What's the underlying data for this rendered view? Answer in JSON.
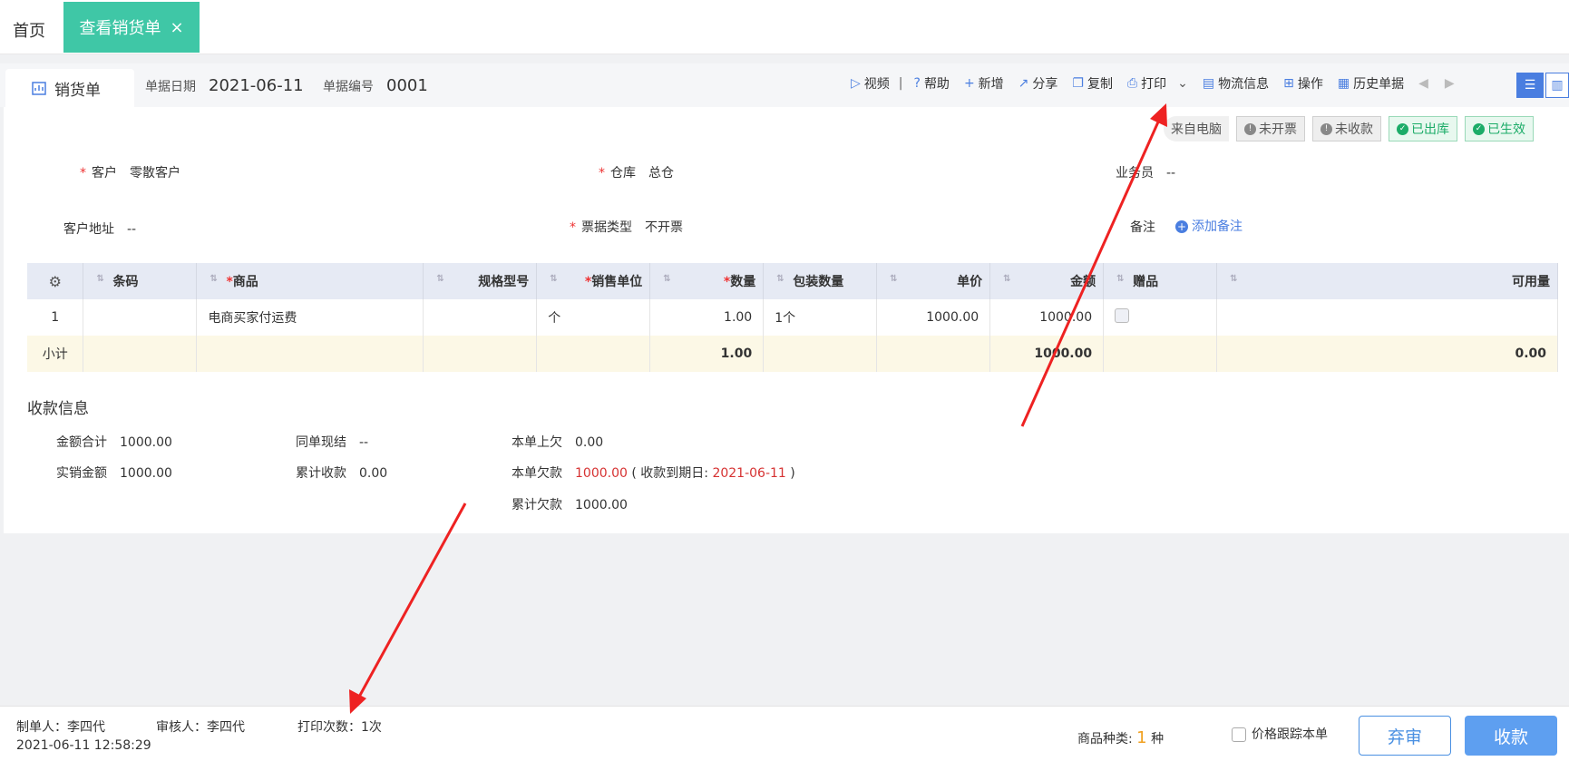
{
  "tabs": {
    "home": "首页",
    "active": "查看销货单",
    "close": "×"
  },
  "doc": {
    "title": "销货单",
    "date_label": "单据日期",
    "date": "2021-06-11",
    "no_label": "单据编号",
    "no": "0001"
  },
  "toolbar": {
    "video": "视频",
    "help": "帮助",
    "add": "新增",
    "share": "分享",
    "copy": "复制",
    "print": "打印",
    "logistics": "物流信息",
    "ops": "操作",
    "history": "历史单据",
    "sep": "|"
  },
  "badges": {
    "source": "来自电脑",
    "invoice": "未开票",
    "receipt": "未收款",
    "outbound": "已出库",
    "effective": "已生效"
  },
  "fields": {
    "customer_label": "客户",
    "customer": "零散客户",
    "warehouse_label": "仓库",
    "warehouse": "总仓",
    "salesman_label": "业务员",
    "salesman": "--",
    "address_label": "客户地址",
    "address": "--",
    "invoice_type_label": "票据类型",
    "invoice_type": "不开票",
    "note_label": "备注",
    "add_note": "添加备注"
  },
  "grid": {
    "headers": {
      "barcode": "条码",
      "product": "商品",
      "spec": "规格型号",
      "unit": "销售单位",
      "qty": "数量",
      "pack": "包装数量",
      "price": "单价",
      "amount": "金额",
      "gift": "赠品",
      "avail": "可用量"
    },
    "row": {
      "idx": "1",
      "product": "电商买家付运费",
      "unit": "个",
      "qty": "1.00",
      "pack": "1个",
      "price": "1000.00",
      "amount": "1000.00"
    },
    "subtotal": {
      "label": "小计",
      "qty": "1.00",
      "amount": "1000.00",
      "avail": "0.00"
    }
  },
  "payment": {
    "title": "收款信息",
    "total_label": "金额合计",
    "total": "1000.00",
    "same_label": "同单现结",
    "same": "--",
    "prev_owe_label": "本单上欠",
    "prev_owe": "0.00",
    "actual_label": "实销金额",
    "actual": "1000.00",
    "cum_recv_label": "累计收款",
    "cum_recv": "0.00",
    "owe_label": "本单欠款",
    "owe": "1000.00",
    "due_prefix": "( 收款到期日:",
    "due_date": "2021-06-11",
    "due_suffix": ")",
    "cum_owe_label": "累计欠款",
    "cum_owe": "1000.00"
  },
  "footer": {
    "creator": "制单人：李四代",
    "auditor": "审核人：李四代",
    "print_count": "打印次数：1次",
    "timestamp": "2021-06-11 12:58:29",
    "kinds_label": "商品种类:",
    "kinds": "1",
    "kinds_unit": "种",
    "track_label": "价格跟踪本单",
    "abandon": "弃审",
    "collect": "收款"
  },
  "colors": {
    "accent": "#3fc7a6",
    "primary": "#5e9ff0",
    "annotation_arrow": "#ee2222"
  }
}
